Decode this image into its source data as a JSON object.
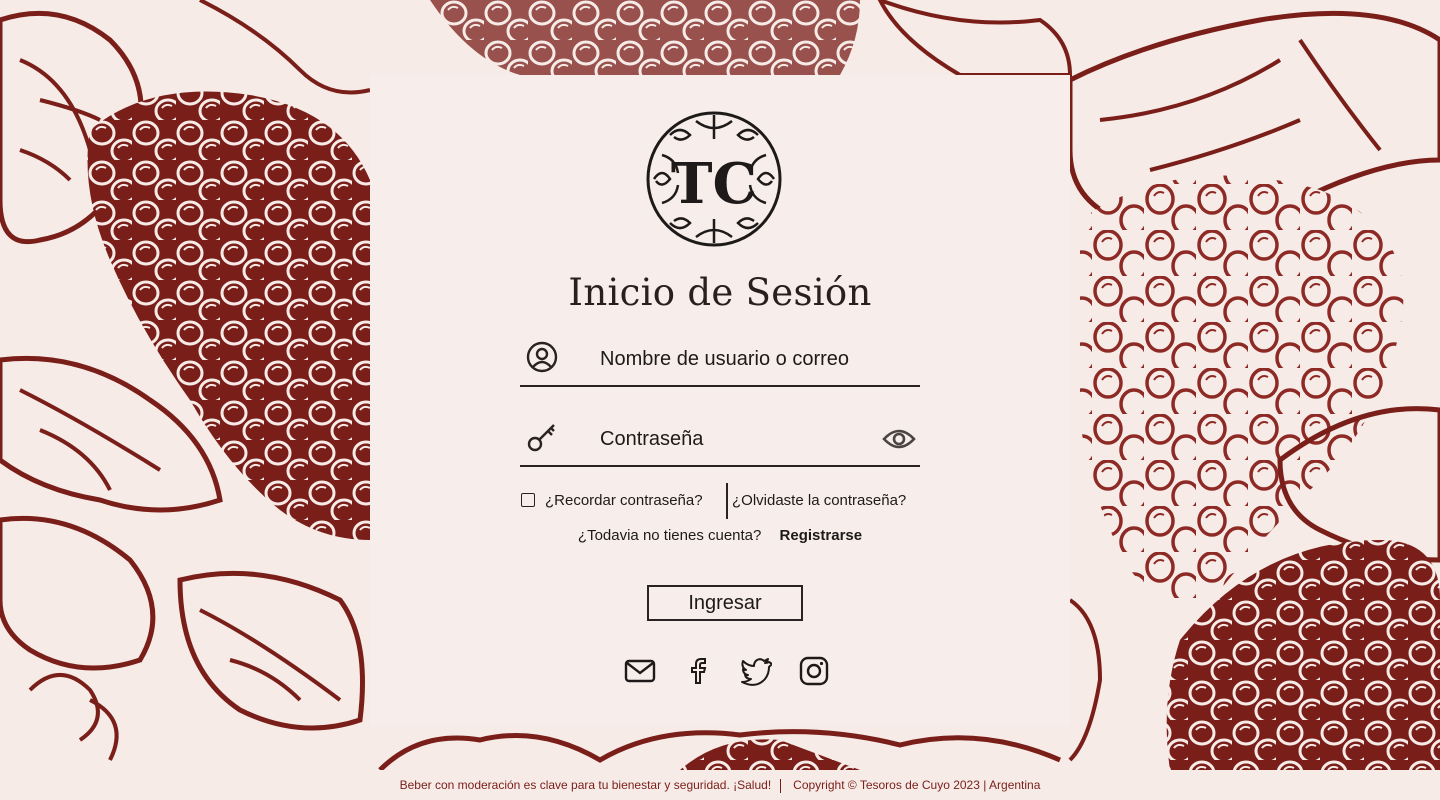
{
  "brand": {
    "monogram": "TC"
  },
  "login": {
    "title": "Inicio de Sesión",
    "username_placeholder": "Nombre de usuario o correo",
    "password_placeholder": "Contraseña",
    "remember_label": "¿Recordar contraseña?",
    "forgot_label": "¿Olvidaste la contraseña?",
    "no_account_text": "¿Todavia no tienes cuenta?",
    "register_label": "Registrarse",
    "submit_label": "Ingresar"
  },
  "social": [
    "mail-icon",
    "facebook-icon",
    "twitter-icon",
    "instagram-icon"
  ],
  "footer": {
    "message": "Beber con moderación es clave para tu bienestar y seguridad. ¡Salud!",
    "copyright": "Copyright © Tesoros de Cuyo 2023 | Argentina"
  },
  "colors": {
    "background": "#f6ebe6",
    "card": "#f7eeeb",
    "grape": "#7a1e1a",
    "grape_light": "#a65552",
    "text": "#1e1a1a"
  }
}
